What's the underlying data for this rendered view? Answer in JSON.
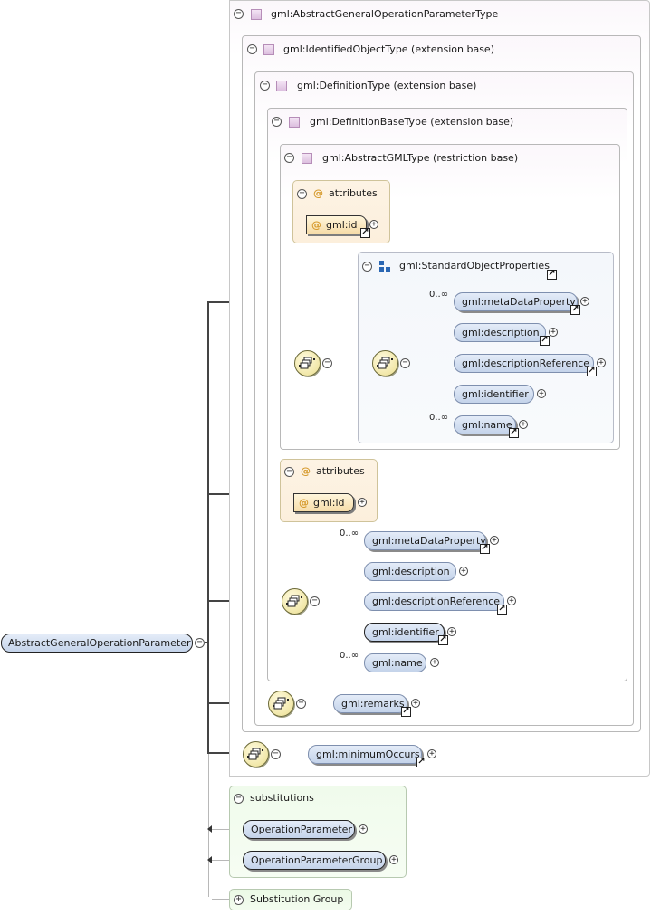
{
  "root": {
    "label": "AbstractGeneralOperationParameter"
  },
  "types": {
    "abstract_general": "gml:AbstractGeneralOperationParameterType",
    "identified_object": "gml:IdentifiedObjectType (extension base)",
    "definition": "gml:DefinitionType (extension base)",
    "definition_base": "gml:DefinitionBaseType (extension base)",
    "abstract_gml": "gml:AbstractGMLType (restriction base)"
  },
  "attributes_label": "attributes",
  "attribute_id": "gml:id",
  "standard_object_properties": {
    "title": "gml:StandardObjectProperties",
    "elements": [
      {
        "label": "gml:metaDataProperty",
        "cardinality": "0..∞"
      },
      {
        "label": "gml:description",
        "cardinality": ""
      },
      {
        "label": "gml:descriptionReference",
        "cardinality": ""
      },
      {
        "label": "gml:identifier",
        "cardinality": ""
      },
      {
        "label": "gml:name",
        "cardinality": "0..∞"
      }
    ]
  },
  "definition_base_sequence": [
    {
      "label": "gml:metaDataProperty",
      "cardinality": "0..∞"
    },
    {
      "label": "gml:description",
      "cardinality": ""
    },
    {
      "label": "gml:descriptionReference",
      "cardinality": ""
    },
    {
      "label": "gml:identifier",
      "cardinality": ""
    },
    {
      "label": "gml:name",
      "cardinality": "0..∞"
    }
  ],
  "remarks": "gml:remarks",
  "minimum_occurs": "gml:minimumOccurs",
  "substitutions": {
    "title": "substitutions",
    "items": [
      "OperationParameter",
      "OperationParameterGroup"
    ]
  },
  "substitution_group": "Substitution Group",
  "icons": {
    "collapse": "minus-circle-icon",
    "expand": "plus-circle-icon",
    "reference": "reference-arrow-icon",
    "sequence": "sequence-compositor-icon",
    "complex_type": "complex-type-icon",
    "attribute": "at-sign-icon",
    "group": "model-group-icon"
  },
  "colors": {
    "element_fill": "#c4d3ea",
    "attribute_fill": "#f6dca8",
    "type_box": "#fbf7fb",
    "substitution_box": "#f0fbec",
    "sequence_fill": "#f1e7a8"
  }
}
